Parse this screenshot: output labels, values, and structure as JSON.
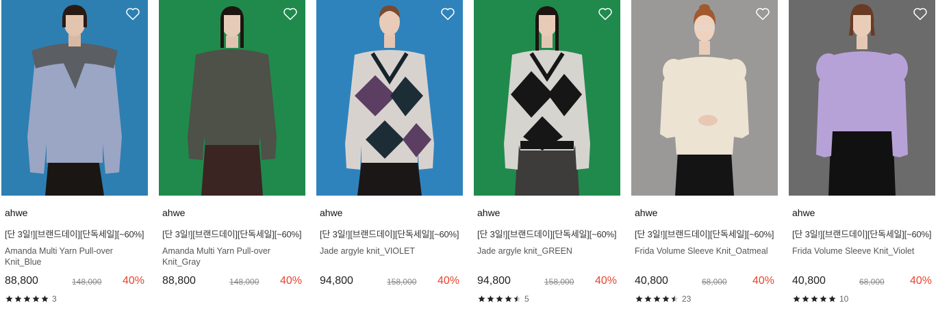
{
  "products": [
    {
      "brand": "ahwe",
      "promo": "[단 3일!][브랜드데이][단독세일][~60%]",
      "name": "Amanda Multi Yarn Pull-over Knit_Blue",
      "price": "88,800",
      "original_price": "148,000",
      "discount": "40%",
      "rating": 5,
      "review_count": "3",
      "bg_color": "#2d7fb2",
      "top_color": "#9aa6c4"
    },
    {
      "brand": "ahwe",
      "promo": "[단 3일!][브랜드데이][단독세일][~60%]",
      "name": "Amanda Multi Yarn Pull-over Knit_Gray",
      "price": "88,800",
      "original_price": "148,000",
      "discount": "40%",
      "rating": null,
      "review_count": null,
      "bg_color": "#1f8a4c",
      "top_color": "#4d5148"
    },
    {
      "brand": "ahwe",
      "promo": "[단 3일!][브랜드데이][단독세일][~60%]",
      "name": "Jade argyle knit_VIOLET",
      "price": "94,800",
      "original_price": "158,000",
      "discount": "40%",
      "rating": null,
      "review_count": null,
      "bg_color": "#2f83bd",
      "top_color": "#d8d2cf"
    },
    {
      "brand": "ahwe",
      "promo": "[단 3일!][브랜드데이][단독세일][~60%]",
      "name": "Jade argyle knit_GREEN",
      "price": "94,800",
      "original_price": "158,000",
      "discount": "40%",
      "rating": 4.5,
      "review_count": "5",
      "bg_color": "#1f8a4c",
      "top_color": "#d6d4cf"
    },
    {
      "brand": "ahwe",
      "promo": "[단 3일!][브랜드데이][단독세일][~60%]",
      "name": "Frida Volume Sleeve Knit_Oatmeal",
      "price": "40,800",
      "original_price": "68,000",
      "discount": "40%",
      "rating": 4.5,
      "review_count": "23",
      "bg_color": "#9a9998",
      "top_color": "#ece3d3"
    },
    {
      "brand": "ahwe",
      "promo": "[단 3일!][브랜드데이][단독세일][~60%]",
      "name": "Frida Volume Sleeve Knit_Violet",
      "price": "40,800",
      "original_price": "68,000",
      "discount": "40%",
      "rating": 5,
      "review_count": "10",
      "bg_color": "#6b6b6b",
      "top_color": "#b7a2d8"
    }
  ],
  "icons": {
    "wishlist": "heart-outline-icon",
    "star": "star-icon"
  },
  "colors": {
    "discount": "#e8432d",
    "star": "#222222"
  }
}
